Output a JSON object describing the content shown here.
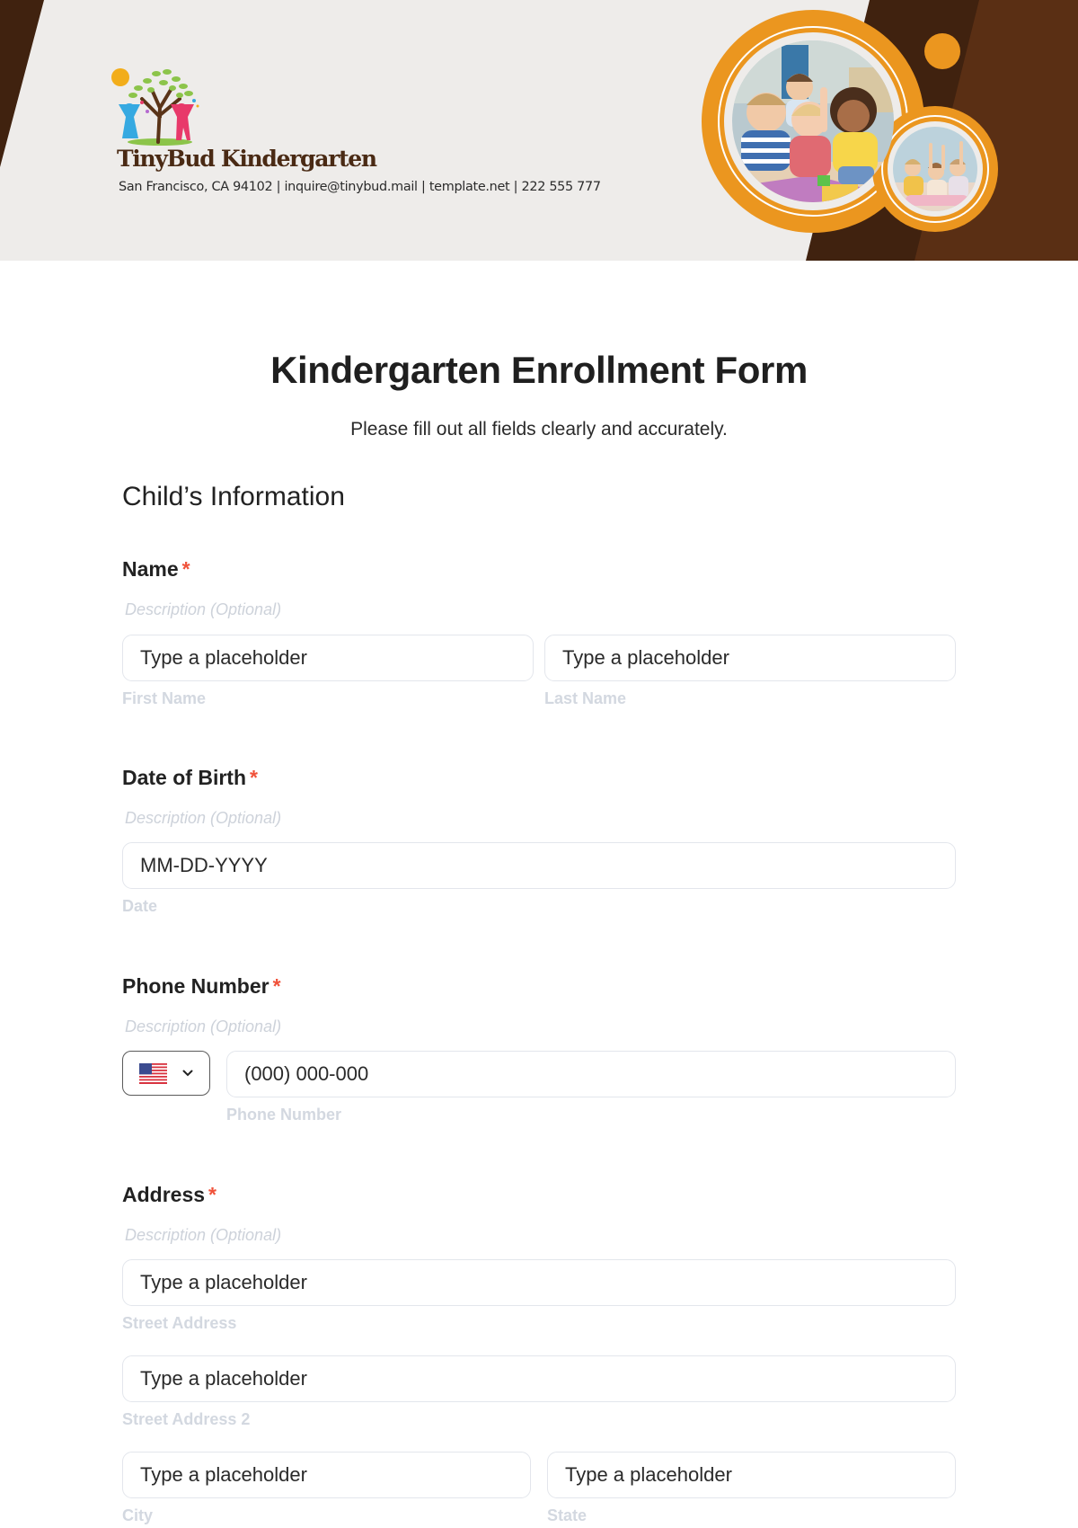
{
  "header": {
    "school_name": "TinyBud Kindergarten",
    "contact_line": "San Francisco, CA 94102 | inquire@tinybud.mail | template.net | 222 555 777",
    "logo_icon": "tree-with-children-logo",
    "photos": [
      {
        "name": "children-sitting-photo",
        "alt": "Happy children sitting on classroom floor"
      },
      {
        "name": "children-raising-hands-photo",
        "alt": "Children raising hands in class"
      }
    ],
    "colors": {
      "background": "#eeecea",
      "dark_brown": "#40220f",
      "medium_brown": "#5a2f14",
      "orange": "#eb961f",
      "logo_text": "#4a2a14"
    }
  },
  "form": {
    "title": "Kindergarten Enrollment Form",
    "subtitle": "Please fill out all fields clearly and accurately.",
    "section_title": "Child’s Information",
    "required_marker": "*",
    "fields": {
      "name": {
        "label": "Name",
        "description": "Description (Optional)",
        "first": {
          "placeholder": "Type a placeholder",
          "sublabel": "First Name"
        },
        "last": {
          "placeholder": "Type a placeholder",
          "sublabel": "Last Name"
        }
      },
      "dob": {
        "label": "Date of Birth",
        "description": "Description (Optional)",
        "placeholder": "MM-DD-YYYY",
        "sublabel": "Date"
      },
      "phone": {
        "label": "Phone Number",
        "description": "Description (Optional)",
        "country": "US",
        "country_icon": "us-flag-icon",
        "placeholder": "(000) 000-000",
        "sublabel": "Phone Number"
      },
      "address": {
        "label": "Address",
        "description": "Description (Optional)",
        "street": {
          "placeholder": "Type a placeholder",
          "sublabel": "Street Address"
        },
        "street2": {
          "placeholder": "Type a placeholder",
          "sublabel": "Street Address 2"
        },
        "city": {
          "placeholder": "Type a placeholder",
          "sublabel": "City"
        },
        "state": {
          "placeholder": "Type a placeholder",
          "sublabel": "State"
        }
      }
    }
  }
}
